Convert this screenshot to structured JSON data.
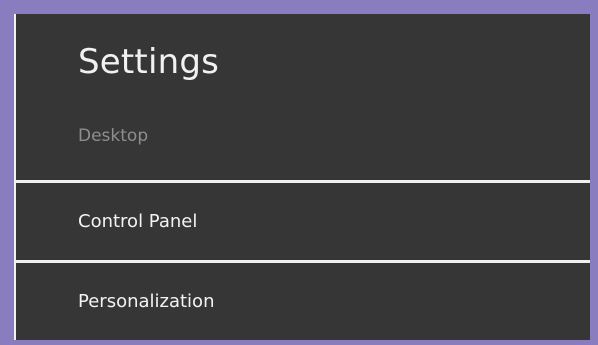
{
  "header": {
    "title": "Settings",
    "subtitle": "Desktop"
  },
  "menu": {
    "items": [
      {
        "label": "Control Panel"
      },
      {
        "label": "Personalization"
      }
    ]
  },
  "colors": {
    "background": "#8a7dbf",
    "panel": "#363636",
    "divider": "#efefef",
    "text_primary": "#f1f1f1",
    "text_secondary": "#8e8e8e"
  }
}
